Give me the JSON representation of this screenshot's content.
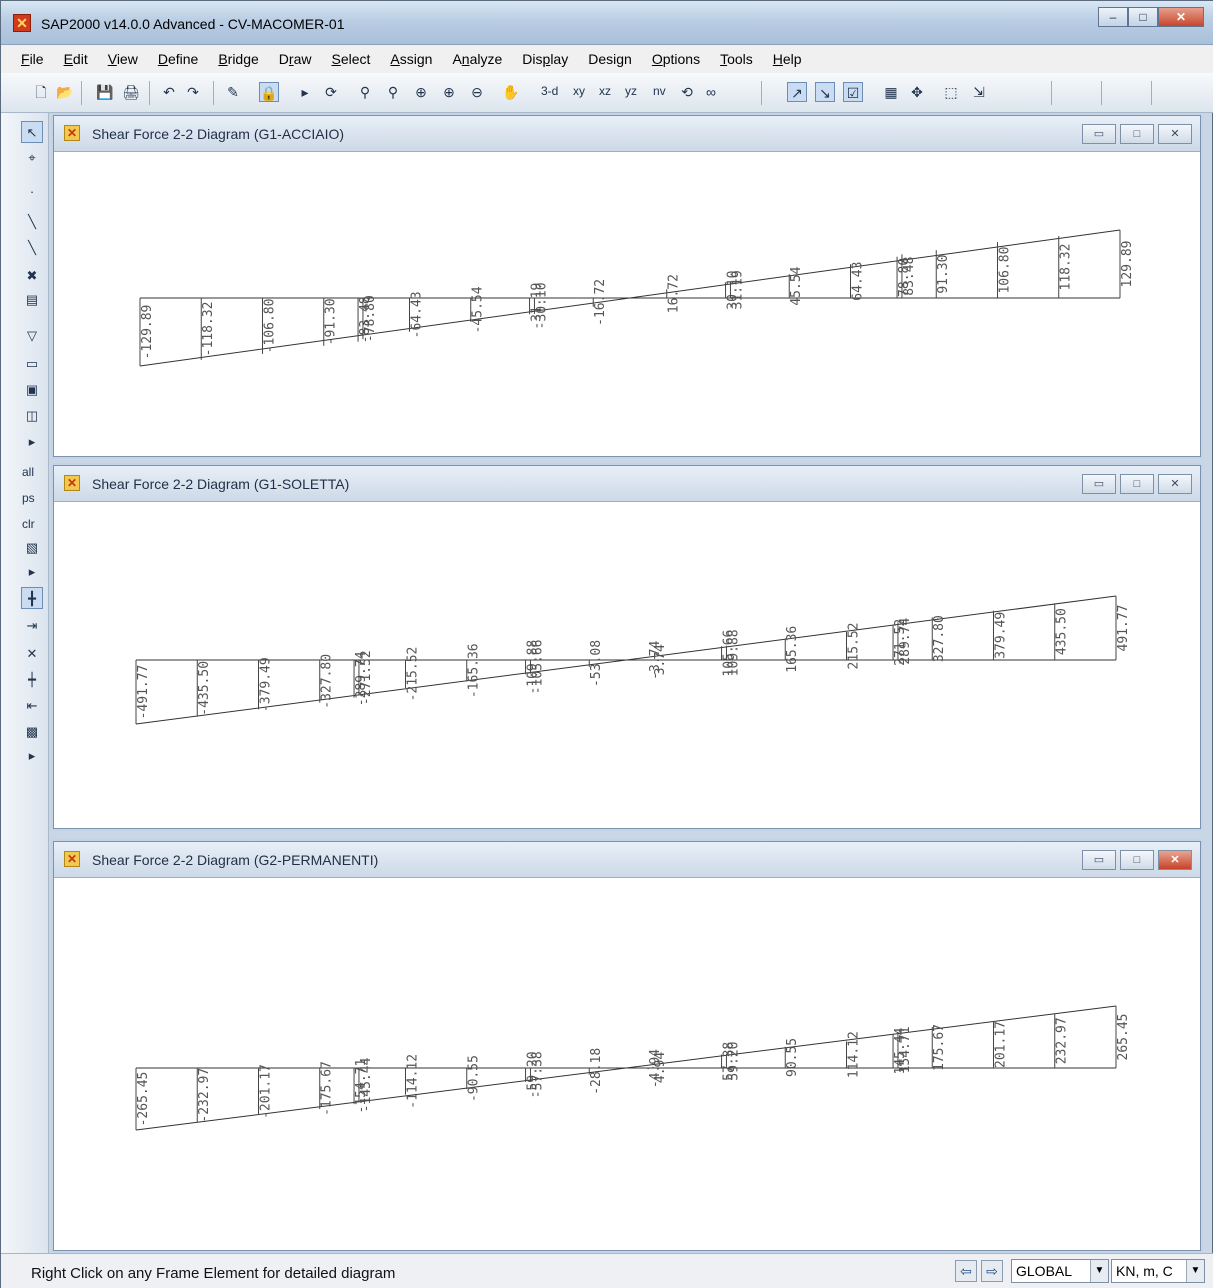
{
  "app": {
    "title": "SAP2000 v14.0.0 Advanced  - CV-MACOMER-01",
    "window_controls": {
      "minimize": "–",
      "maximize": "□",
      "close": "✕"
    }
  },
  "menu": [
    {
      "label": "File",
      "u": "F",
      "rest": "ile"
    },
    {
      "label": "Edit",
      "u": "E",
      "rest": "dit"
    },
    {
      "label": "View",
      "u": "V",
      "rest": "iew"
    },
    {
      "label": "Define",
      "u": "D",
      "rest": "efine"
    },
    {
      "label": "Bridge",
      "u": "B",
      "rest": "ridge"
    },
    {
      "label": "Draw",
      "pre": "D",
      "u": "r",
      "rest": "aw"
    },
    {
      "label": "Select",
      "u": "S",
      "rest": "elect"
    },
    {
      "label": "Assign",
      "u": "A",
      "rest": "ssign"
    },
    {
      "label": "Analyze",
      "pre": "A",
      "u": "n",
      "rest": "alyze"
    },
    {
      "label": "Display",
      "pre": "Dis",
      "u": "p",
      "rest": "lay"
    },
    {
      "label": "Design",
      "pre": "Desi",
      "u": "g",
      "rest": "n"
    },
    {
      "label": "Options",
      "u": "O",
      "rest": "ptions"
    },
    {
      "label": "Tools",
      "u": "T",
      "rest": "ools"
    },
    {
      "label": "Help",
      "u": "H",
      "rest": "elp"
    }
  ],
  "toolbar": {
    "view_3d": "3-d",
    "view_xy": "xy",
    "view_xz": "xz",
    "view_yz": "yz",
    "view_nv": "nv"
  },
  "left_toolbar": {
    "select_all": "all",
    "previous_select": "ps",
    "clear_select": "clr"
  },
  "windows": [
    {
      "title": "Shear Force 2-2 Diagram   (G1-ACCIAIO)",
      "chart_data": {
        "type": "line",
        "x": [
          0,
          2.5,
          5,
          7.5,
          8.9,
          9.1,
          11,
          13.5,
          15.9,
          16.1,
          18.5,
          21.5,
          23.9,
          24.1,
          26.5,
          29,
          30.9,
          31.1,
          32.5,
          35,
          37.5,
          40
        ],
        "values": [
          -129.89,
          -118.32,
          -106.8,
          -91.3,
          -83.48,
          -78.8,
          -64.43,
          -45.54,
          -31.19,
          -30.1,
          -16.72,
          16.72,
          30.1,
          31.19,
          45.54,
          64.43,
          78.8,
          83.48,
          91.3,
          106.8,
          118.32,
          129.89
        ],
        "labels": [
          "-129.89",
          "-118.32",
          "-106.80",
          "-91.30",
          "-83.48",
          "-78.80",
          "-64.43",
          "-45.54",
          "-31.19",
          "-30.10",
          "-16.72",
          "16.72",
          "30.10",
          "31.19",
          "45.54",
          "64.43",
          "78.80",
          "83.48",
          "91.30",
          "106.80",
          "118.32",
          "129.89"
        ],
        "grid": false
      }
    },
    {
      "title": "Shear Force 2-2 Diagram   (G1-SOLETTA)",
      "chart_data": {
        "type": "line",
        "x": [
          0,
          2.5,
          5,
          7.5,
          8.9,
          9.1,
          11,
          13.5,
          15.9,
          16.1,
          18.5,
          20.9,
          21.1,
          23.9,
          24.1,
          26.5,
          29,
          30.9,
          31.1,
          32.5,
          35,
          37.5,
          40
        ],
        "values": [
          -491.77,
          -435.5,
          -379.49,
          -327.8,
          -289.74,
          -271.52,
          -215.52,
          -165.36,
          -109.88,
          -105.66,
          -53.08,
          -3.74,
          3.74,
          105.66,
          109.88,
          165.36,
          215.52,
          271.52,
          289.74,
          327.8,
          379.49,
          435.5,
          491.77
        ],
        "labels": [
          "-491.77",
          "-435.50",
          "-379.49",
          "-327.80",
          "-289.74",
          "-271.52",
          "-215.52",
          "-165.36",
          "-109.88",
          "-105.66",
          "-53.08",
          "-3.74",
          "3.74",
          "105.66",
          "109.88",
          "165.36",
          "215.52",
          "271.52",
          "289.74",
          "327.80",
          "379.49",
          "435.50",
          "491.77"
        ],
        "grid": false
      }
    },
    {
      "title": "Shear Force 2-2 Diagram   (G2-PERMANENTI)",
      "chart_data": {
        "type": "line",
        "x": [
          0,
          2.5,
          5,
          7.5,
          8.9,
          9.1,
          11,
          13.5,
          15.9,
          16.1,
          18.5,
          20.9,
          21.1,
          23.9,
          24.1,
          26.5,
          29,
          30.9,
          31.1,
          32.5,
          35,
          37.5,
          40
        ],
        "values": [
          -265.45,
          -232.97,
          -201.17,
          -175.67,
          -154.71,
          -145.44,
          -114.12,
          -90.55,
          -59.2,
          -57.38,
          -28.18,
          -4.94,
          4.94,
          57.38,
          59.2,
          90.55,
          114.12,
          145.44,
          154.71,
          175.67,
          201.17,
          232.97,
          265.45
        ],
        "labels": [
          "-265.45",
          "-232.97",
          "-201.17",
          "-175.67",
          "-154.71",
          "-145.44",
          "-114.12",
          "-90.55",
          "-59.20",
          "-57.38",
          "-28.18",
          "-4.94",
          "4.94",
          "57.38",
          "59.20",
          "90.55",
          "114.12",
          "145.44",
          "154.71",
          "175.67",
          "201.17",
          "232.97",
          "265.45"
        ],
        "grid": false
      }
    }
  ],
  "status": {
    "message": "Right Click on any Frame Element for detailed diagram",
    "coord_system": "GLOBAL",
    "units": "KN, m, C"
  }
}
